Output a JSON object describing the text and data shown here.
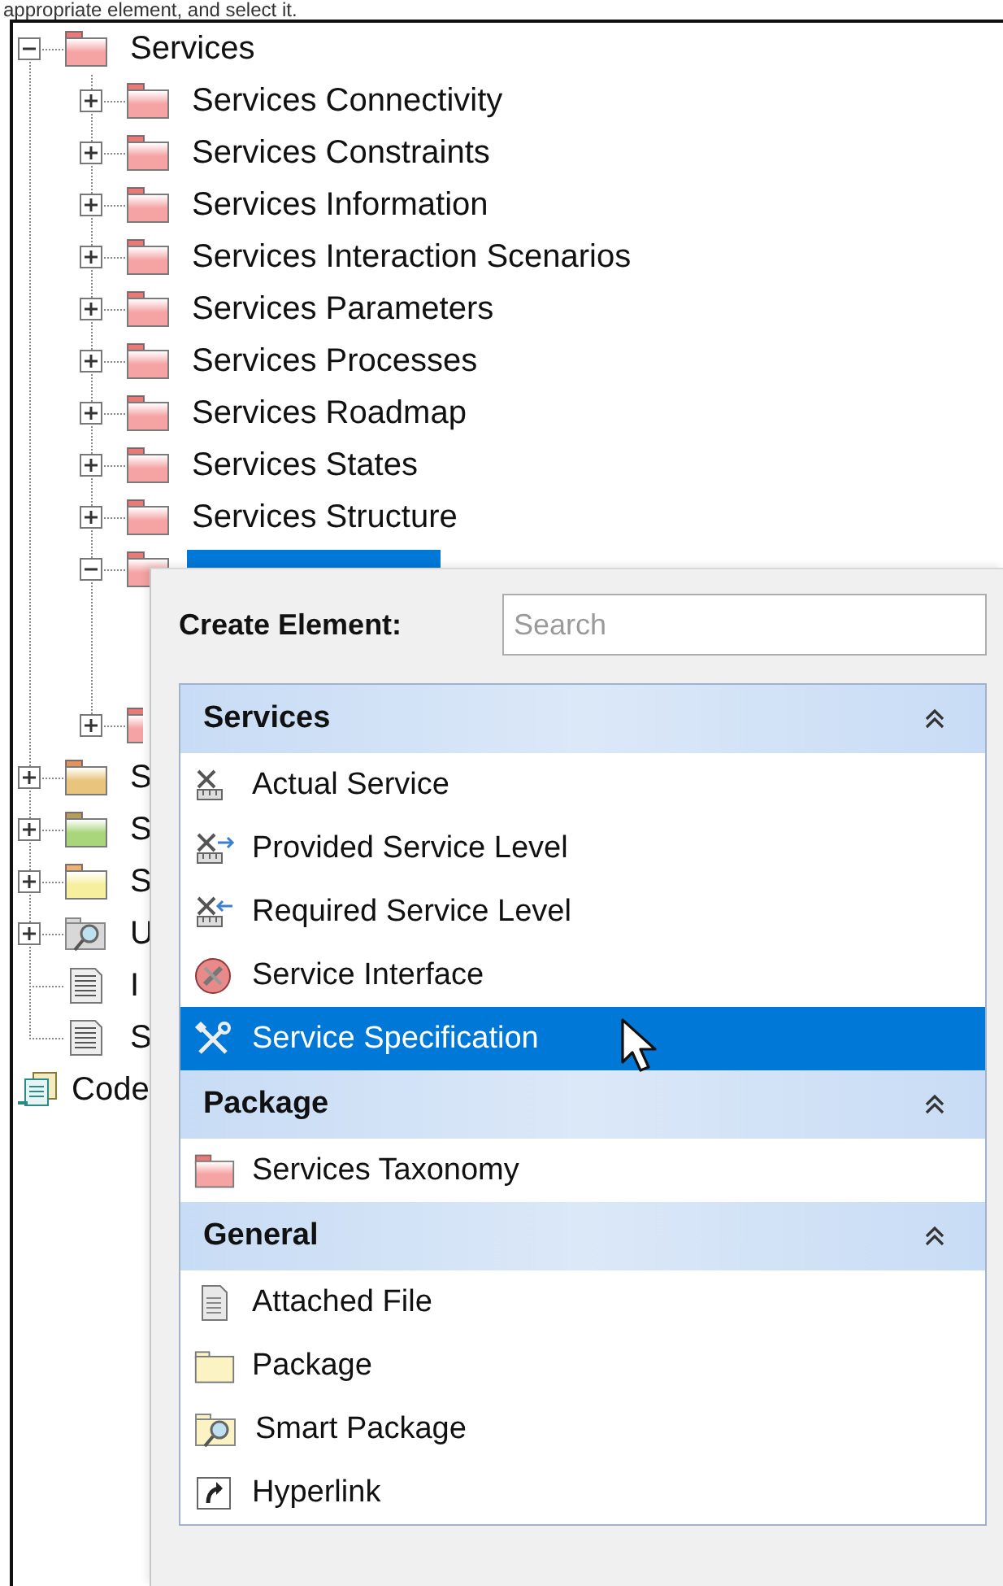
{
  "caption": "appropriate element, and select it.",
  "tree": [
    {
      "label": "Services",
      "kind": "package",
      "color": "#f5a3a3",
      "expanded": true,
      "selected": false,
      "children": [
        {
          "label": "Services Connectivity",
          "kind": "package",
          "color": "#f5a3a3",
          "expanded": false,
          "selected": false
        },
        {
          "label": "Services Constraints",
          "kind": "package",
          "color": "#f5a3a3",
          "expanded": false,
          "selected": false
        },
        {
          "label": "Services Information",
          "kind": "package",
          "color": "#f5a3a3",
          "expanded": false,
          "selected": false
        },
        {
          "label": "Services Interaction Scenarios",
          "kind": "package",
          "color": "#f5a3a3",
          "expanded": false,
          "selected": false
        },
        {
          "label": "Services Parameters",
          "kind": "package",
          "color": "#f5a3a3",
          "expanded": false,
          "selected": false
        },
        {
          "label": "Services Processes",
          "kind": "package",
          "color": "#f5a3a3",
          "expanded": false,
          "selected": false
        },
        {
          "label": "Services Roadmap",
          "kind": "package",
          "color": "#f5a3a3",
          "expanded": false,
          "selected": false
        },
        {
          "label": "Services States",
          "kind": "package",
          "color": "#f5a3a3",
          "expanded": false,
          "selected": false
        },
        {
          "label": "Services Structure",
          "kind": "package",
          "color": "#f5a3a3",
          "expanded": false,
          "selected": false
        },
        {
          "kind": "package",
          "color": "#f5a3a3",
          "expanded": true,
          "selected": true
        },
        {
          "kind": "package",
          "color": "#f5a3a3",
          "expanded": false
        }
      ]
    },
    {
      "label": "S",
      "kind": "package",
      "color": "#e9c47c",
      "expanded": false,
      "selected": false
    },
    {
      "label": "S",
      "kind": "package",
      "color": "#a9d67a",
      "expanded": false,
      "selected": false
    },
    {
      "label": "S",
      "kind": "package",
      "color": "#f6ef9e",
      "expanded": false,
      "selected": false
    },
    {
      "label": "U",
      "kind": "smart-package",
      "expanded": false,
      "selected": false
    },
    {
      "label": "I",
      "kind": "document",
      "selected": false
    },
    {
      "label": "S",
      "kind": "document",
      "selected": false
    },
    {
      "label": "Code",
      "kind": "code",
      "selected": false
    }
  ],
  "create_element": {
    "label": "Create Element:",
    "search": {
      "placeholder": "Search"
    },
    "sections": [
      {
        "title": "Services",
        "expanded": true,
        "items": [
          {
            "label": "Actual Service",
            "kind": "actual-service",
            "selected": false
          },
          {
            "label": "Provided Service Level",
            "kind": "provided-level",
            "selected": false
          },
          {
            "label": "Required Service Level",
            "kind": "required-level",
            "selected": false
          },
          {
            "label": "Service Interface",
            "kind": "service-interface",
            "selected": false
          },
          {
            "label": "Service Specification",
            "kind": "service-specification",
            "selected": true
          }
        ]
      },
      {
        "title": "Package",
        "expanded": true,
        "items": [
          {
            "label": "Services Taxonomy",
            "kind": "pink-package",
            "selected": false
          }
        ]
      },
      {
        "title": "General",
        "expanded": true,
        "items": [
          {
            "label": "Attached File",
            "kind": "attached-file",
            "selected": false
          },
          {
            "label": "Package",
            "kind": "package",
            "selected": false
          },
          {
            "label": "Smart Package",
            "kind": "smart-package",
            "selected": false
          },
          {
            "label": "Hyperlink",
            "kind": "hyperlink",
            "selected": false
          }
        ]
      }
    ]
  }
}
